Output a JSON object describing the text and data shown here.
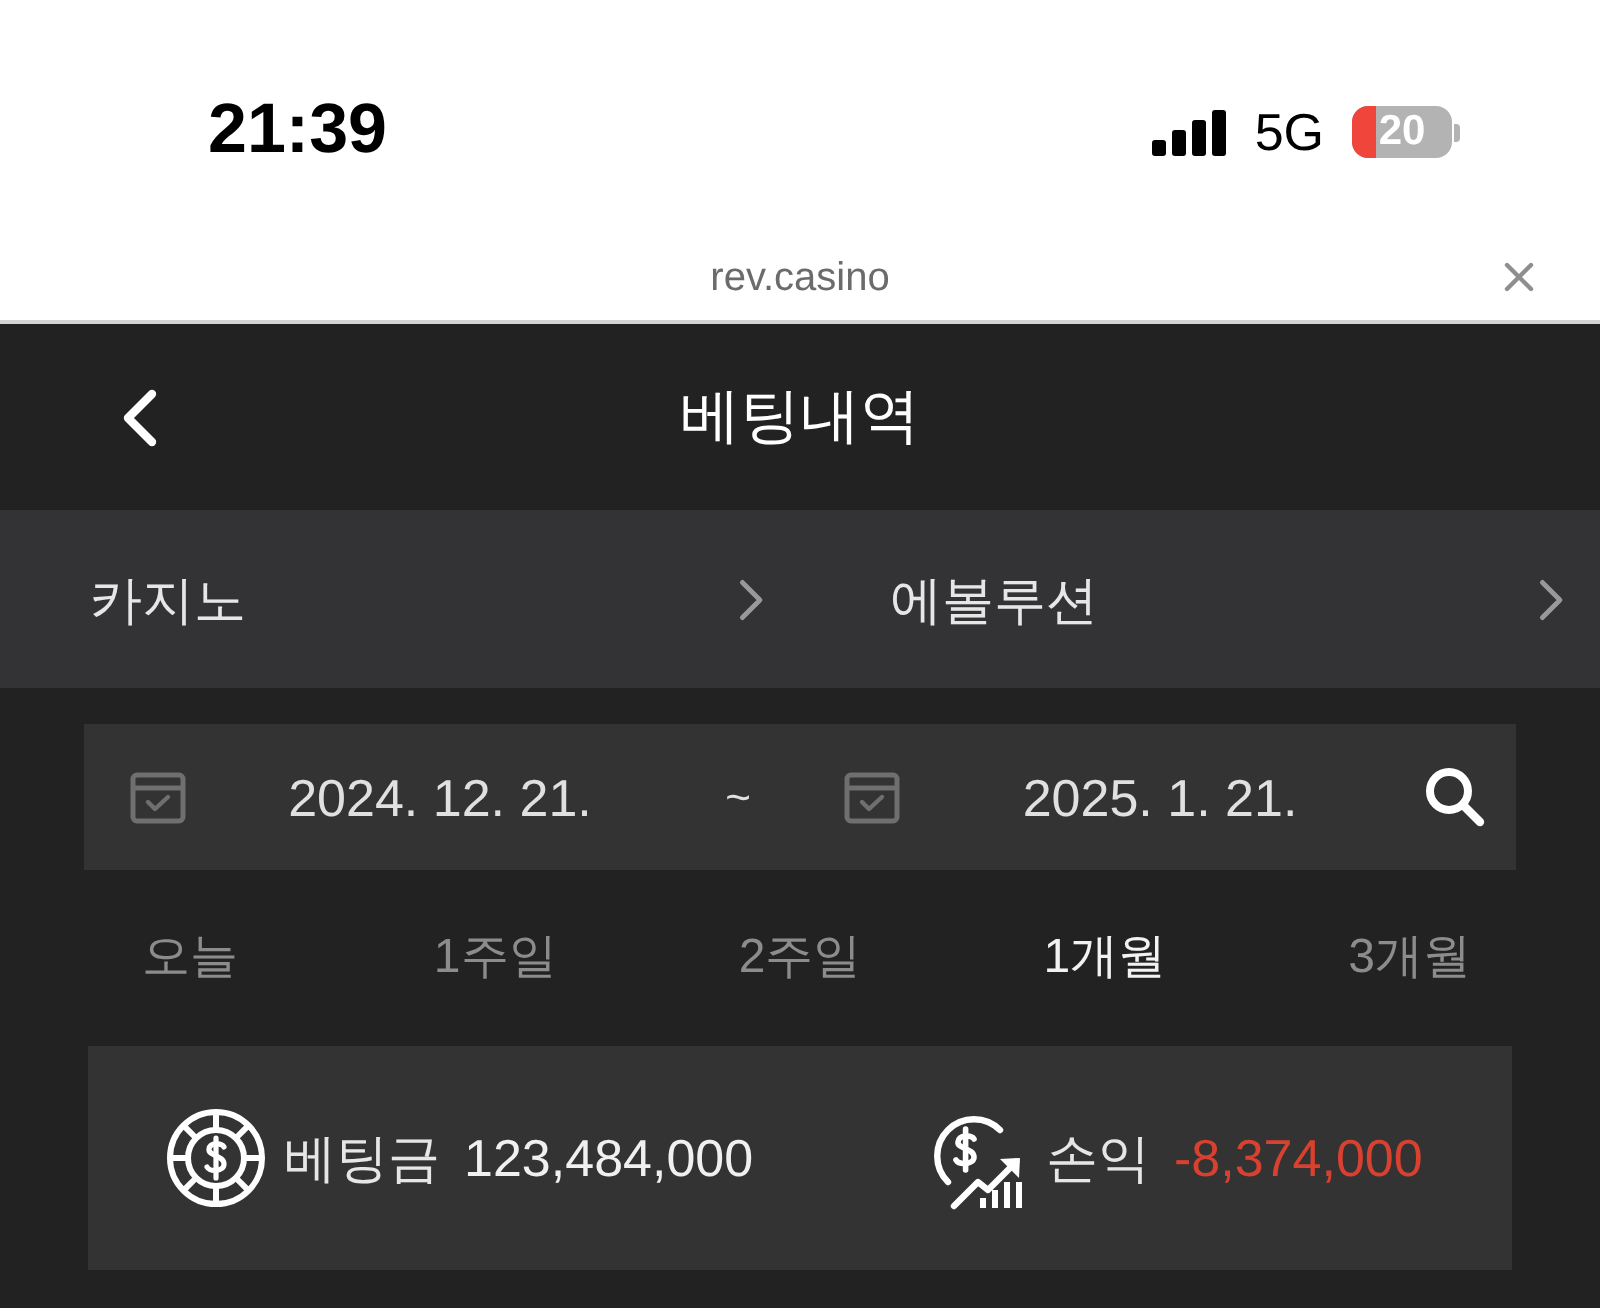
{
  "status_bar": {
    "time": "21:39",
    "network": "5G",
    "battery": "20"
  },
  "url_bar": {
    "url": "rev.casino"
  },
  "header": {
    "title": "베팅내역"
  },
  "breadcrumbs": [
    {
      "label": "카지노"
    },
    {
      "label": "에볼루션"
    }
  ],
  "date_range": {
    "start": "2024. 12. 21.",
    "separator": "~",
    "end": "2025. 1. 21."
  },
  "periods": [
    {
      "label": "오늘",
      "selected": false
    },
    {
      "label": "1주일",
      "selected": false
    },
    {
      "label": "2주일",
      "selected": false
    },
    {
      "label": "1개월",
      "selected": true
    },
    {
      "label": "3개월",
      "selected": false
    }
  ],
  "summary": [
    {
      "kind": "bet",
      "label": "베팅금",
      "value": "123,484,000",
      "negative": false
    },
    {
      "kind": "profit",
      "label": "손익",
      "value": "-8,374,000",
      "negative": true
    }
  ]
}
